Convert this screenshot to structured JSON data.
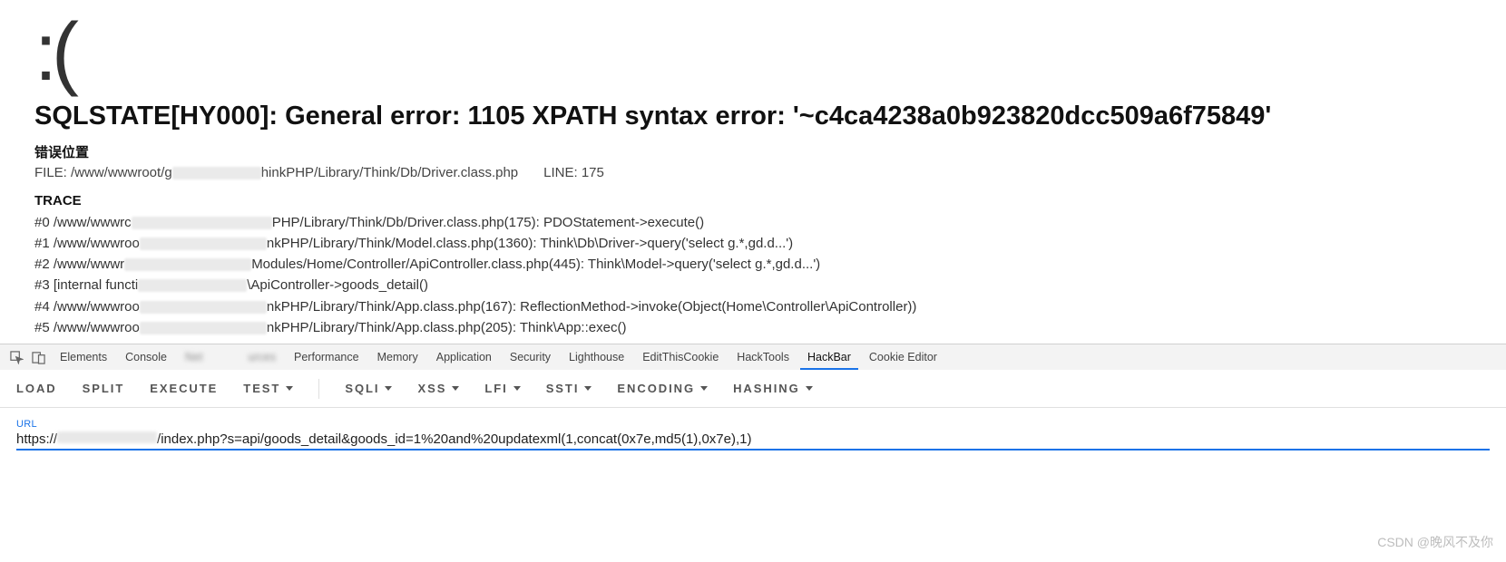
{
  "sadface": ":(",
  "error_title": "SQLSTATE[HY000]: General error: 1105 XPATH syntax error: '~c4ca4238a0b923820dcc509a6f75849'",
  "location": {
    "heading": "错误位置",
    "file_prefix": "FILE: /www/wwwroot/g",
    "file_suffix": "hinkPHP/Library/Think/Db/Driver.class.php",
    "line_label": "LINE: 175"
  },
  "trace": {
    "heading": "TRACE",
    "rows": [
      {
        "pre": "#0 /www/wwwrc",
        "suf": "PHP/Library/Think/Db/Driver.class.php(175): PDOStatement->execute()"
      },
      {
        "pre": "#1 /www/wwwroo",
        "suf": "nkPHP/Library/Think/Model.class.php(1360): Think\\Db\\Driver->query('select g.*,gd.d...')"
      },
      {
        "pre": "#2 /www/wwwr",
        "suf": "Modules/Home/Controller/ApiController.class.php(445): Think\\Model->query('select g.*,gd.d...')"
      },
      {
        "pre": "#3 [internal functi",
        "suf": "\\ApiController->goods_detail()"
      },
      {
        "pre": "#4 /www/wwwroo",
        "suf": "nkPHP/Library/Think/App.class.php(167): ReflectionMethod->invoke(Object(Home\\Controller\\ApiController))"
      },
      {
        "pre": "#5 /www/wwwroo",
        "suf": "nkPHP/Library/Think/App.class.php(205): Think\\App::exec()"
      }
    ]
  },
  "devtools": {
    "tabs": [
      "Elements",
      "Console",
      "Net",
      "urces",
      "Performance",
      "Memory",
      "Application",
      "Security",
      "Lighthouse",
      "EditThisCookie",
      "HackTools",
      "HackBar",
      "Cookie Editor"
    ],
    "active": "HackBar"
  },
  "hackbar": {
    "buttons": {
      "load": "LOAD",
      "split": "SPLIT",
      "execute": "EXECUTE",
      "test": "TEST",
      "sqli": "SQLI",
      "xss": "XSS",
      "lfi": "LFI",
      "ssti": "SSTI",
      "encoding": "ENCODING",
      "hashing": "HASHING"
    },
    "url_label": "URL",
    "url_prefix": "https://",
    "url_suffix": "/index.php?s=api/goods_detail&goods_id=1%20and%20updatexml(1,concat(0x7e,md5(1),0x7e),1)"
  },
  "watermark": "CSDN @晚风不及你"
}
